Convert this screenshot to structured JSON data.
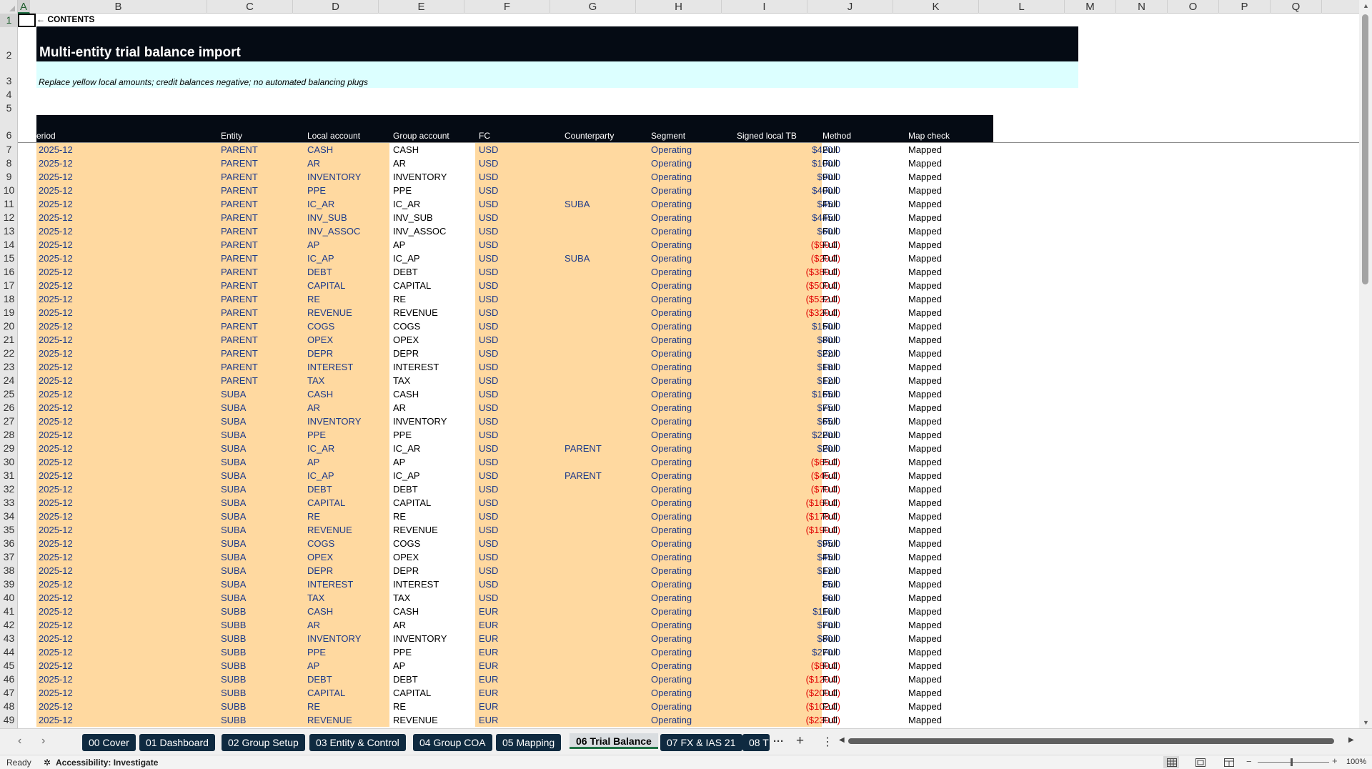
{
  "columns": [
    "A",
    "B",
    "C",
    "D",
    "E",
    "F",
    "G",
    "H",
    "I",
    "J",
    "K",
    "L",
    "M",
    "N",
    "O",
    "P",
    "Q"
  ],
  "selected_column": "A",
  "selected_row": 1,
  "sheet": {
    "contents_link": "← CONTENTS",
    "title": "Multi-entity trial balance import",
    "subtitle": "Replace yellow local amounts; credit balances negative; no automated balancing plugs",
    "headers": {
      "period": "Period",
      "entity": "Entity",
      "local_account": "Local account",
      "group_account": "Group account",
      "fc": "FC",
      "counterparty": "Counterparty",
      "segment": "Segment",
      "signed_local_tb": "Signed local TB",
      "method": "Method",
      "map_check": "Map check"
    },
    "rows": [
      {
        "row": "7",
        "period": "2025-12",
        "entity": "PARENT",
        "local": "CASH",
        "group": "CASH",
        "fc": "USD",
        "cp": "",
        "segment": "Operating",
        "amount": "$420.0",
        "neg": false,
        "method": "Full",
        "map": "Mapped"
      },
      {
        "row": "8",
        "period": "2025-12",
        "entity": "PARENT",
        "local": "AR",
        "group": "AR",
        "fc": "USD",
        "cp": "",
        "segment": "Operating",
        "amount": "$100.0",
        "neg": false,
        "method": "Full",
        "map": "Mapped"
      },
      {
        "row": "9",
        "period": "2025-12",
        "entity": "PARENT",
        "local": "INVENTORY",
        "group": "INVENTORY",
        "fc": "USD",
        "cp": "",
        "segment": "Operating",
        "amount": "$90.0",
        "neg": false,
        "method": "Full",
        "map": "Mapped"
      },
      {
        "row": "10",
        "period": "2025-12",
        "entity": "PARENT",
        "local": "PPE",
        "group": "PPE",
        "fc": "USD",
        "cp": "",
        "segment": "Operating",
        "amount": "$400.0",
        "neg": false,
        "method": "Full",
        "map": "Mapped"
      },
      {
        "row": "11",
        "period": "2025-12",
        "entity": "PARENT",
        "local": "IC_AR",
        "group": "IC_AR",
        "fc": "USD",
        "cp": "SUBA",
        "segment": "Operating",
        "amount": "$45.0",
        "neg": false,
        "method": "Full",
        "map": "Mapped"
      },
      {
        "row": "12",
        "period": "2025-12",
        "entity": "PARENT",
        "local": "INV_SUB",
        "group": "INV_SUB",
        "fc": "USD",
        "cp": "",
        "segment": "Operating",
        "amount": "$445.0",
        "neg": false,
        "method": "Full",
        "map": "Mapped"
      },
      {
        "row": "13",
        "period": "2025-12",
        "entity": "PARENT",
        "local": "INV_ASSOC",
        "group": "INV_ASSOC",
        "fc": "USD",
        "cp": "",
        "segment": "Operating",
        "amount": "$60.0",
        "neg": false,
        "method": "Full",
        "map": "Mapped"
      },
      {
        "row": "14",
        "period": "2025-12",
        "entity": "PARENT",
        "local": "AP",
        "group": "AP",
        "fc": "USD",
        "cp": "",
        "segment": "Operating",
        "amount": "($90.0)",
        "neg": true,
        "method": "Full",
        "map": "Mapped"
      },
      {
        "row": "15",
        "period": "2025-12",
        "entity": "PARENT",
        "local": "IC_AP",
        "group": "IC_AP",
        "fc": "USD",
        "cp": "SUBA",
        "segment": "Operating",
        "amount": "($20.0)",
        "neg": true,
        "method": "Full",
        "map": "Mapped"
      },
      {
        "row": "16",
        "period": "2025-12",
        "entity": "PARENT",
        "local": "DEBT",
        "group": "DEBT",
        "fc": "USD",
        "cp": "",
        "segment": "Operating",
        "amount": "($380.0)",
        "neg": true,
        "method": "Full",
        "map": "Mapped"
      },
      {
        "row": "17",
        "period": "2025-12",
        "entity": "PARENT",
        "local": "CAPITAL",
        "group": "CAPITAL",
        "fc": "USD",
        "cp": "",
        "segment": "Operating",
        "amount": "($500.0)",
        "neg": true,
        "method": "Full",
        "map": "Mapped"
      },
      {
        "row": "18",
        "period": "2025-12",
        "entity": "PARENT",
        "local": "RE",
        "group": "RE",
        "fc": "USD",
        "cp": "",
        "segment": "Operating",
        "amount": "($532.0)",
        "neg": true,
        "method": "Full",
        "map": "Mapped"
      },
      {
        "row": "19",
        "period": "2025-12",
        "entity": "PARENT",
        "local": "REVENUE",
        "group": "REVENUE",
        "fc": "USD",
        "cp": "",
        "segment": "Operating",
        "amount": "($320.0)",
        "neg": true,
        "method": "Full",
        "map": "Mapped"
      },
      {
        "row": "20",
        "period": "2025-12",
        "entity": "PARENT",
        "local": "COGS",
        "group": "COGS",
        "fc": "USD",
        "cp": "",
        "segment": "Operating",
        "amount": "$150.0",
        "neg": false,
        "method": "Full",
        "map": "Mapped"
      },
      {
        "row": "21",
        "period": "2025-12",
        "entity": "PARENT",
        "local": "OPEX",
        "group": "OPEX",
        "fc": "USD",
        "cp": "",
        "segment": "Operating",
        "amount": "$80.0",
        "neg": false,
        "method": "Full",
        "map": "Mapped"
      },
      {
        "row": "22",
        "period": "2025-12",
        "entity": "PARENT",
        "local": "DEPR",
        "group": "DEPR",
        "fc": "USD",
        "cp": "",
        "segment": "Operating",
        "amount": "$22.0",
        "neg": false,
        "method": "Full",
        "map": "Mapped"
      },
      {
        "row": "23",
        "period": "2025-12",
        "entity": "PARENT",
        "local": "INTEREST",
        "group": "INTEREST",
        "fc": "USD",
        "cp": "",
        "segment": "Operating",
        "amount": "$18.0",
        "neg": false,
        "method": "Full",
        "map": "Mapped"
      },
      {
        "row": "24",
        "period": "2025-12",
        "entity": "PARENT",
        "local": "TAX",
        "group": "TAX",
        "fc": "USD",
        "cp": "",
        "segment": "Operating",
        "amount": "$12.0",
        "neg": false,
        "method": "Full",
        "map": "Mapped"
      },
      {
        "row": "25",
        "period": "2025-12",
        "entity": "SUBA",
        "local": "CASH",
        "group": "CASH",
        "fc": "USD",
        "cp": "",
        "segment": "Operating",
        "amount": "$165.0",
        "neg": false,
        "method": "Full",
        "map": "Mapped"
      },
      {
        "row": "26",
        "period": "2025-12",
        "entity": "SUBA",
        "local": "AR",
        "group": "AR",
        "fc": "USD",
        "cp": "",
        "segment": "Operating",
        "amount": "$75.0",
        "neg": false,
        "method": "Full",
        "map": "Mapped"
      },
      {
        "row": "27",
        "period": "2025-12",
        "entity": "SUBA",
        "local": "INVENTORY",
        "group": "INVENTORY",
        "fc": "USD",
        "cp": "",
        "segment": "Operating",
        "amount": "$65.0",
        "neg": false,
        "method": "Full",
        "map": "Mapped"
      },
      {
        "row": "28",
        "period": "2025-12",
        "entity": "SUBA",
        "local": "PPE",
        "group": "PPE",
        "fc": "USD",
        "cp": "",
        "segment": "Operating",
        "amount": "$220.0",
        "neg": false,
        "method": "Full",
        "map": "Mapped"
      },
      {
        "row": "29",
        "period": "2025-12",
        "entity": "SUBA",
        "local": "IC_AR",
        "group": "IC_AR",
        "fc": "USD",
        "cp": "PARENT",
        "segment": "Operating",
        "amount": "$20.0",
        "neg": false,
        "method": "Full",
        "map": "Mapped"
      },
      {
        "row": "30",
        "period": "2025-12",
        "entity": "SUBA",
        "local": "AP",
        "group": "AP",
        "fc": "USD",
        "cp": "",
        "segment": "Operating",
        "amount": "($65.0)",
        "neg": true,
        "method": "Full",
        "map": "Mapped"
      },
      {
        "row": "31",
        "period": "2025-12",
        "entity": "SUBA",
        "local": "IC_AP",
        "group": "IC_AP",
        "fc": "USD",
        "cp": "PARENT",
        "segment": "Operating",
        "amount": "($45.0)",
        "neg": true,
        "method": "Full",
        "map": "Mapped"
      },
      {
        "row": "32",
        "period": "2025-12",
        "entity": "SUBA",
        "local": "DEBT",
        "group": "DEBT",
        "fc": "USD",
        "cp": "",
        "segment": "Operating",
        "amount": "($70.0)",
        "neg": true,
        "method": "Full",
        "map": "Mapped"
      },
      {
        "row": "33",
        "period": "2025-12",
        "entity": "SUBA",
        "local": "CAPITAL",
        "group": "CAPITAL",
        "fc": "USD",
        "cp": "",
        "segment": "Operating",
        "amount": "($160.0)",
        "neg": true,
        "method": "Full",
        "map": "Mapped"
      },
      {
        "row": "34",
        "period": "2025-12",
        "entity": "SUBA",
        "local": "RE",
        "group": "RE",
        "fc": "USD",
        "cp": "",
        "segment": "Operating",
        "amount": "($178.0)",
        "neg": true,
        "method": "Full",
        "map": "Mapped"
      },
      {
        "row": "35",
        "period": "2025-12",
        "entity": "SUBA",
        "local": "REVENUE",
        "group": "REVENUE",
        "fc": "USD",
        "cp": "",
        "segment": "Operating",
        "amount": "($190.0)",
        "neg": true,
        "method": "Full",
        "map": "Mapped"
      },
      {
        "row": "36",
        "period": "2025-12",
        "entity": "SUBA",
        "local": "COGS",
        "group": "COGS",
        "fc": "USD",
        "cp": "",
        "segment": "Operating",
        "amount": "$95.0",
        "neg": false,
        "method": "Full",
        "map": "Mapped"
      },
      {
        "row": "37",
        "period": "2025-12",
        "entity": "SUBA",
        "local": "OPEX",
        "group": "OPEX",
        "fc": "USD",
        "cp": "",
        "segment": "Operating",
        "amount": "$45.0",
        "neg": false,
        "method": "Full",
        "map": "Mapped"
      },
      {
        "row": "38",
        "period": "2025-12",
        "entity": "SUBA",
        "local": "DEPR",
        "group": "DEPR",
        "fc": "USD",
        "cp": "",
        "segment": "Operating",
        "amount": "$12.0",
        "neg": false,
        "method": "Full",
        "map": "Mapped"
      },
      {
        "row": "39",
        "period": "2025-12",
        "entity": "SUBA",
        "local": "INTEREST",
        "group": "INTEREST",
        "fc": "USD",
        "cp": "",
        "segment": "Operating",
        "amount": "$5.0",
        "neg": false,
        "method": "Full",
        "map": "Mapped"
      },
      {
        "row": "40",
        "period": "2025-12",
        "entity": "SUBA",
        "local": "TAX",
        "group": "TAX",
        "fc": "USD",
        "cp": "",
        "segment": "Operating",
        "amount": "$6.0",
        "neg": false,
        "method": "Full",
        "map": "Mapped"
      },
      {
        "row": "41",
        "period": "2025-12",
        "entity": "SUBB",
        "local": "CASH",
        "group": "CASH",
        "fc": "EUR",
        "cp": "",
        "segment": "Operating",
        "amount": "$110.0",
        "neg": false,
        "method": "Full",
        "map": "Mapped"
      },
      {
        "row": "42",
        "period": "2025-12",
        "entity": "SUBB",
        "local": "AR",
        "group": "AR",
        "fc": "EUR",
        "cp": "",
        "segment": "Operating",
        "amount": "$70.0",
        "neg": false,
        "method": "Full",
        "map": "Mapped"
      },
      {
        "row": "43",
        "period": "2025-12",
        "entity": "SUBB",
        "local": "INVENTORY",
        "group": "INVENTORY",
        "fc": "EUR",
        "cp": "",
        "segment": "Operating",
        "amount": "$80.0",
        "neg": false,
        "method": "Full",
        "map": "Mapped"
      },
      {
        "row": "44",
        "period": "2025-12",
        "entity": "SUBB",
        "local": "PPE",
        "group": "PPE",
        "fc": "EUR",
        "cp": "",
        "segment": "Operating",
        "amount": "$270.0",
        "neg": false,
        "method": "Full",
        "map": "Mapped"
      },
      {
        "row": "45",
        "period": "2025-12",
        "entity": "SUBB",
        "local": "AP",
        "group": "AP",
        "fc": "EUR",
        "cp": "",
        "segment": "Operating",
        "amount": "($80.0)",
        "neg": true,
        "method": "Full",
        "map": "Mapped"
      },
      {
        "row": "46",
        "period": "2025-12",
        "entity": "SUBB",
        "local": "DEBT",
        "group": "DEBT",
        "fc": "EUR",
        "cp": "",
        "segment": "Operating",
        "amount": "($120.0)",
        "neg": true,
        "method": "Full",
        "map": "Mapped"
      },
      {
        "row": "47",
        "period": "2025-12",
        "entity": "SUBB",
        "local": "CAPITAL",
        "group": "CAPITAL",
        "fc": "EUR",
        "cp": "",
        "segment": "Operating",
        "amount": "($200.0)",
        "neg": true,
        "method": "Full",
        "map": "Mapped"
      },
      {
        "row": "48",
        "period": "2025-12",
        "entity": "SUBB",
        "local": "RE",
        "group": "RE",
        "fc": "EUR",
        "cp": "",
        "segment": "Operating",
        "amount": "($102.0)",
        "neg": true,
        "method": "Full",
        "map": "Mapped"
      },
      {
        "row": "49",
        "period": "2025-12",
        "entity": "SUBB",
        "local": "REVENUE",
        "group": "REVENUE",
        "fc": "EUR",
        "cp": "",
        "segment": "Operating",
        "amount": "($230.0)",
        "neg": true,
        "method": "Full",
        "map": "Mapped"
      }
    ]
  },
  "top_rows": [
    "1",
    "2",
    "3",
    "4",
    "5",
    "6"
  ],
  "tabs": [
    {
      "label": "00 Cover",
      "active": false
    },
    {
      "label": "01 Dashboard",
      "active": false
    },
    {
      "label": "02 Group Setup",
      "active": false
    },
    {
      "label": "03 Entity & Control",
      "active": false
    },
    {
      "label": "04 Group COA",
      "active": false
    },
    {
      "label": "05 Mapping",
      "active": false
    },
    {
      "label": "06 Trial Balance",
      "active": true
    },
    {
      "label": "07 FX & IAS 21",
      "active": false
    },
    {
      "label": "08 T",
      "active": false
    }
  ],
  "tab_more": "···",
  "status": {
    "ready": "Ready",
    "accessibility": "Accessibility: Investigate",
    "zoom": "100%"
  },
  "colors": {
    "input_fill": "#ffd9a0",
    "header_dark": "#050b14",
    "subtitle_fill": "#dcffff",
    "input_text": "#1f3a8a",
    "negative": "#e00000",
    "tab_dark": "#0f2a40"
  },
  "icons": [
    "tab-prev-icon",
    "tab-next-icon",
    "add-sheet-icon",
    "more-options-icon",
    "accessibility-icon",
    "normal-view-icon",
    "page-layout-icon",
    "page-break-icon"
  ]
}
